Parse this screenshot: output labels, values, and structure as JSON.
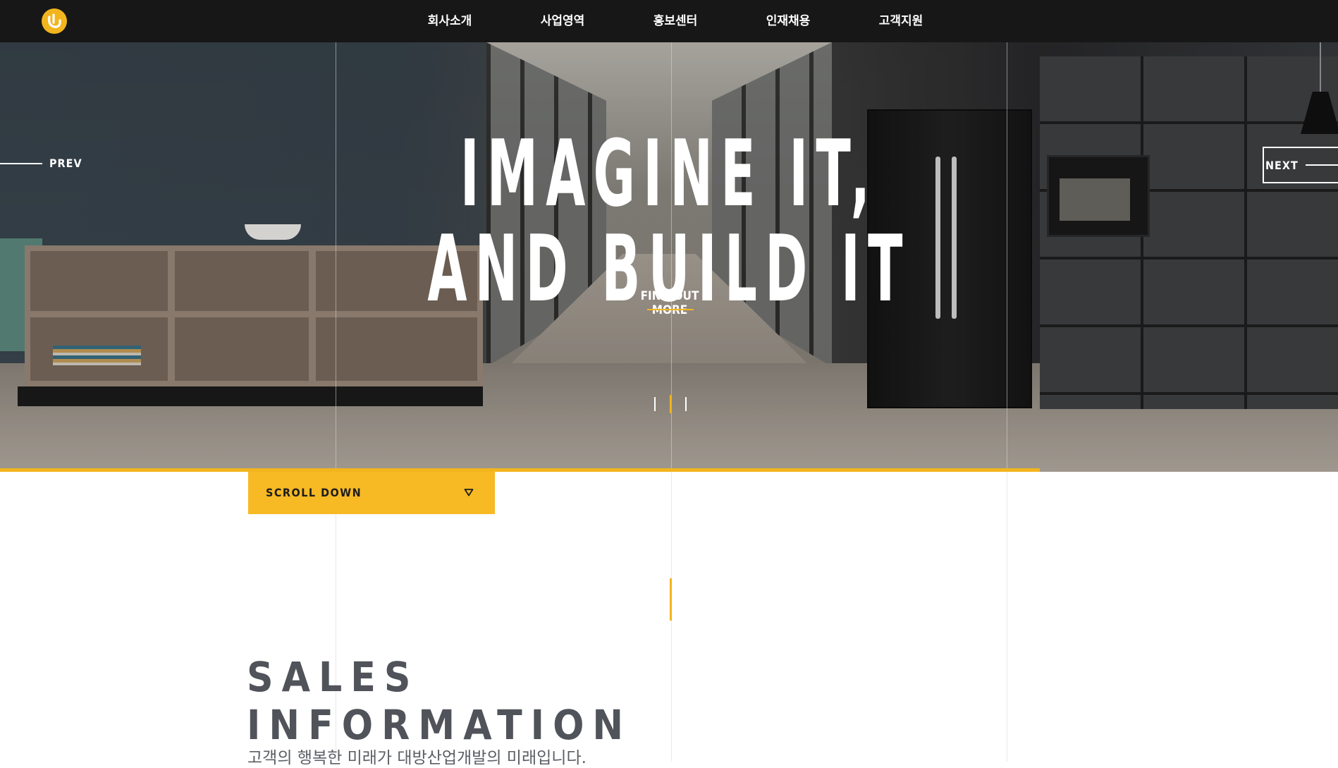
{
  "nav": {
    "items": [
      {
        "label": "회사소개"
      },
      {
        "label": "사업영역"
      },
      {
        "label": "홍보센터"
      },
      {
        "label": "인재채용"
      },
      {
        "label": "고객지원"
      }
    ]
  },
  "hero": {
    "headline": "IMAGINE IT,\nAND BUILD IT",
    "cta_label": "FIND OUT MORE",
    "prev_label": "PREV",
    "next_label": "NEXT",
    "slide_count": 3,
    "active_slide": 2
  },
  "scroll_button": {
    "label": "SCROLL DOWN"
  },
  "sales": {
    "title": "SALES\nINFORMATION",
    "subtitle": "고객의 행복한 미래가 대방산업개발의 미래입니다."
  },
  "colors": {
    "accent": "#f2b51d",
    "nav_background": "#171717",
    "title_text": "#50545a"
  },
  "icons": {
    "logo": "logo-icon",
    "scroll": "chevron-down-icon"
  }
}
